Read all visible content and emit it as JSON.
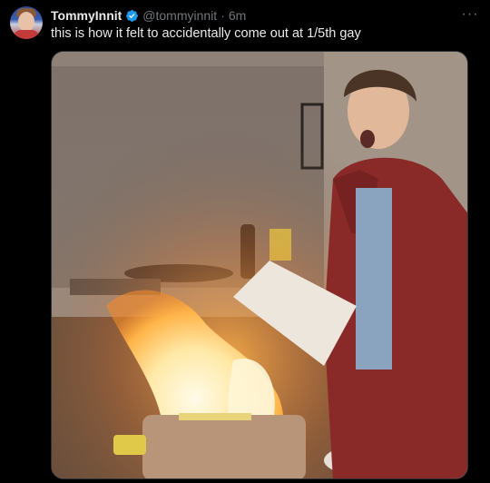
{
  "tweet": {
    "display_name": "TommyInnit",
    "handle": "@tommyinnit",
    "separator": "·",
    "time": "6m",
    "text": "this is how it felt to accidentally come out at 1/5th gay",
    "more_glyph": "···"
  },
  "icons": {
    "verified": "verified-badge-icon",
    "more": "more-options-icon"
  },
  "colors": {
    "background": "#000000",
    "primary_text": "#e7e9ea",
    "secondary_text": "#71767b",
    "verified_blue": "#1d9bf0"
  }
}
